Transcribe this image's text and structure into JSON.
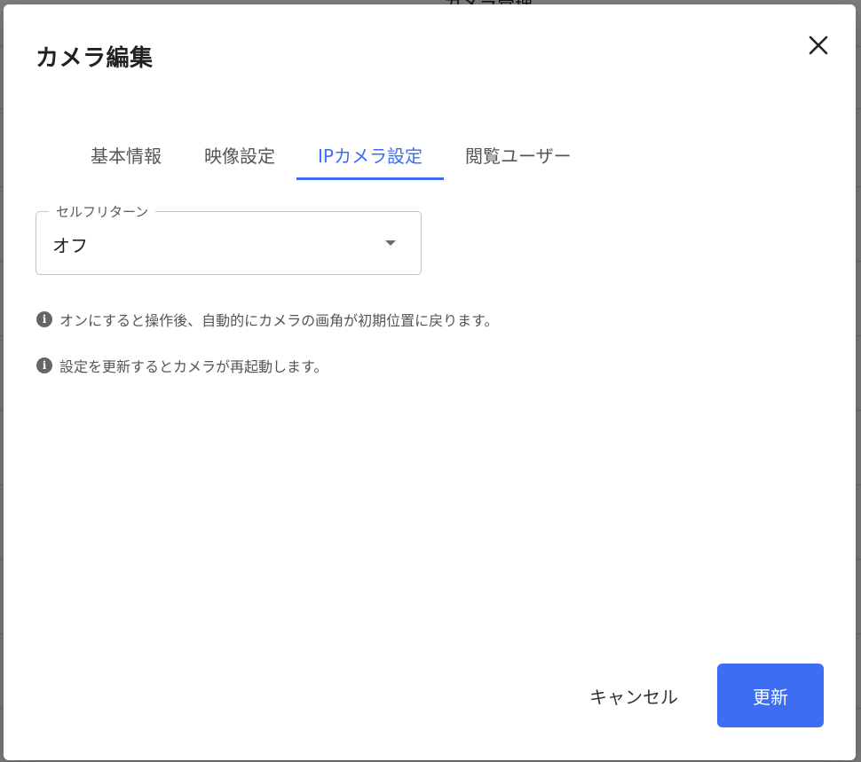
{
  "background": {
    "page_title": "カメラ管理"
  },
  "dialog": {
    "title": "カメラ編集",
    "close_icon": "close-icon",
    "tabs": [
      {
        "label": "基本情報",
        "active": false
      },
      {
        "label": "映像設定",
        "active": false
      },
      {
        "label": "IPカメラ設定",
        "active": true
      },
      {
        "label": "閲覧ユーザー",
        "active": false
      }
    ],
    "selfie_turn": {
      "label": "セルフリターン",
      "value": "オフ"
    },
    "notes": [
      "オンにすると操作後、自動的にカメラの画角が初期位置に戻ります。",
      "設定を更新するとカメラが再起動します。"
    ],
    "cancel_label": "キャンセル",
    "update_label": "更新"
  },
  "colors": {
    "accent": "#3d6df2",
    "scrim": "rgba(0,0,0,0.5)"
  }
}
